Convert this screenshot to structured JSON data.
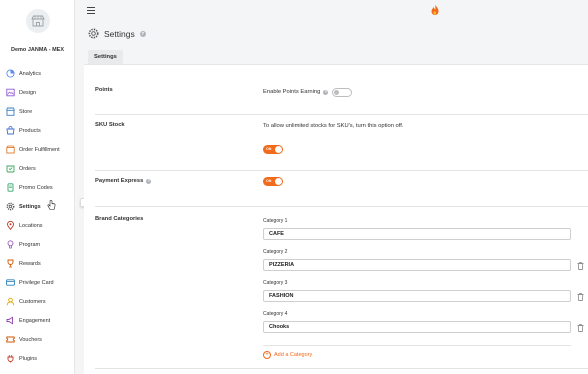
{
  "store": {
    "name": "Demo JANMA - MEX"
  },
  "sidebar": {
    "items": [
      {
        "label": "Analytics",
        "icon": "analytics-icon"
      },
      {
        "label": "Design",
        "icon": "design-icon"
      },
      {
        "label": "Store",
        "icon": "store-icon"
      },
      {
        "label": "Products",
        "icon": "products-icon"
      },
      {
        "label": "Order Fulfillment",
        "icon": "order-fulfillment-icon"
      },
      {
        "label": "Orders",
        "icon": "orders-icon"
      },
      {
        "label": "Promo Codes",
        "icon": "promo-codes-icon"
      },
      {
        "label": "Settings",
        "icon": "gear-icon"
      },
      {
        "label": "Locations",
        "icon": "location-pin-icon"
      },
      {
        "label": "Program",
        "icon": "program-icon"
      },
      {
        "label": "Rewards",
        "icon": "rewards-icon"
      },
      {
        "label": "Privilege Card",
        "icon": "card-icon"
      },
      {
        "label": "Customers",
        "icon": "customers-icon"
      },
      {
        "label": "Engagement",
        "icon": "engagement-icon"
      },
      {
        "label": "Vouchers",
        "icon": "vouchers-icon"
      },
      {
        "label": "Plugins",
        "icon": "plugins-icon"
      }
    ]
  },
  "tooltip": {
    "text": "Settings"
  },
  "page": {
    "title": "Settings",
    "tab": "Settings"
  },
  "settings": {
    "points": {
      "title": "Points",
      "label": "Enable Points Earning",
      "enabled": false
    },
    "sku": {
      "title": "SKU Stock",
      "description": "To allow unlimited stocks for SKU's, turn this option off.",
      "toggle_label": "ON",
      "enabled": true
    },
    "payment_express": {
      "title": "Payment Express",
      "toggle_label": "ON",
      "enabled": true
    },
    "brand_categories": {
      "title": "Brand Categories",
      "categories": [
        {
          "label": "Category 1",
          "value": "CAFE"
        },
        {
          "label": "Category 2",
          "value": "PIZZERIA"
        },
        {
          "label": "Category 3",
          "value": "FASHION"
        },
        {
          "label": "Category 4",
          "value": "Chooks"
        }
      ],
      "add_label": "Add a Category"
    }
  },
  "colors": {
    "accent": "#f26a1b",
    "sidebar_bg": "#ffffff",
    "page_bg": "#f4f5f7"
  }
}
